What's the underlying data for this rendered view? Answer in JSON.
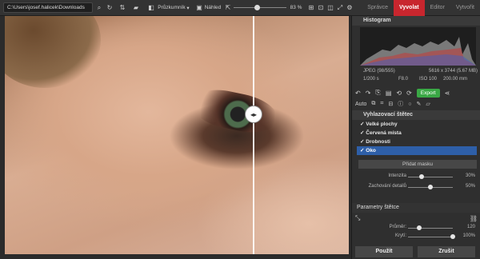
{
  "toolbar": {
    "path": "C:\\Users\\josef.halicek\\Downloads",
    "browser_label": "Průzkumník",
    "preview_label": "Náhled",
    "zoom": "83 %"
  },
  "modes": [
    "Správce",
    "Vyvolat",
    "Editor",
    "Vytvořit"
  ],
  "active_mode": "Vyvolat",
  "panel": {
    "histogram_title": "Histogram",
    "file_info": {
      "format": "JPEG",
      "index": "(98/555)",
      "dimensions": "5616 x 3744 (5.67 MB)",
      "shutter": "1/200 s",
      "aperture": "F8.0",
      "iso": "ISO 100",
      "focal": "200.00 mm"
    },
    "export_label": "Export",
    "auto_label": "Auto",
    "brush_title": "Vyhlazovací štětec",
    "checks": [
      "Velké plochy",
      "Červená místa",
      "Drobnosti",
      "Oko"
    ],
    "selected_check": "Oko",
    "add_mask": "Přidat masku",
    "intensity_label": "Intenzita",
    "intensity_value": "30%",
    "intensity_fraction": 0.3,
    "detail_label": "Zachování detailů",
    "detail_value": "50%",
    "detail_fraction": 0.5,
    "brush_params_title": "Parametry štětce",
    "diameter_label": "Průměr:",
    "diameter_value": "120",
    "diameter_fraction": 0.25,
    "opacity_label": "Krytí:",
    "opacity_value": "100%",
    "opacity_fraction": 1.0,
    "apply_label": "Použít",
    "cancel_label": "Zrušit"
  }
}
